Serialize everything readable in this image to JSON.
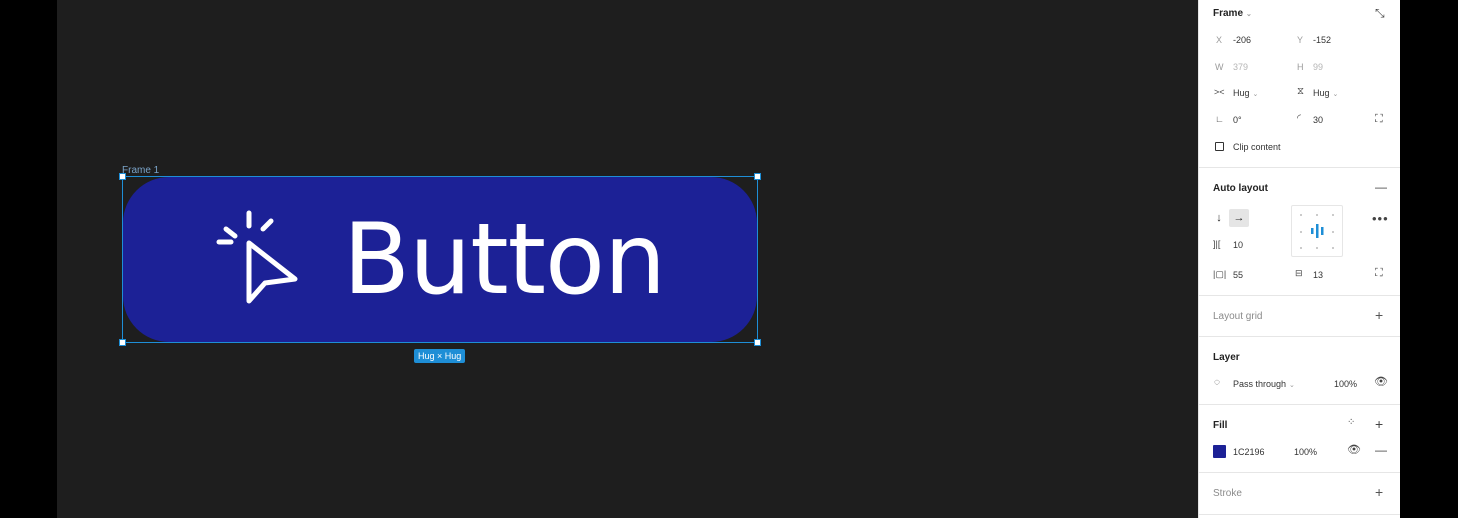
{
  "canvas": {
    "frame_label": "Frame 1",
    "button_label": "Button",
    "button_color": "#1C2196",
    "hug_badge": "Hug × Hug",
    "button_icon": "cursor-click-icon"
  },
  "panel": {
    "frame": {
      "title": "Frame",
      "x_label": "X",
      "x_value": "-206",
      "y_label": "Y",
      "y_value": "-152",
      "w_label": "W",
      "w_value": "379",
      "h_label": "H",
      "h_value": "99",
      "hug_w": "Hug",
      "hug_h": "Hug",
      "rotation": "0°",
      "radius": "30",
      "clip_content": "Clip content"
    },
    "auto_layout": {
      "title": "Auto layout",
      "gap": "10",
      "padding_h": "55",
      "padding_v": "13"
    },
    "layout_grid": {
      "title": "Layout grid"
    },
    "layer": {
      "title": "Layer",
      "blend": "Pass through",
      "opacity": "100%"
    },
    "fill": {
      "title": "Fill",
      "hex": "1C2196",
      "opacity": "100%",
      "swatch_color": "#1C2196"
    },
    "stroke": {
      "title": "Stroke"
    }
  }
}
